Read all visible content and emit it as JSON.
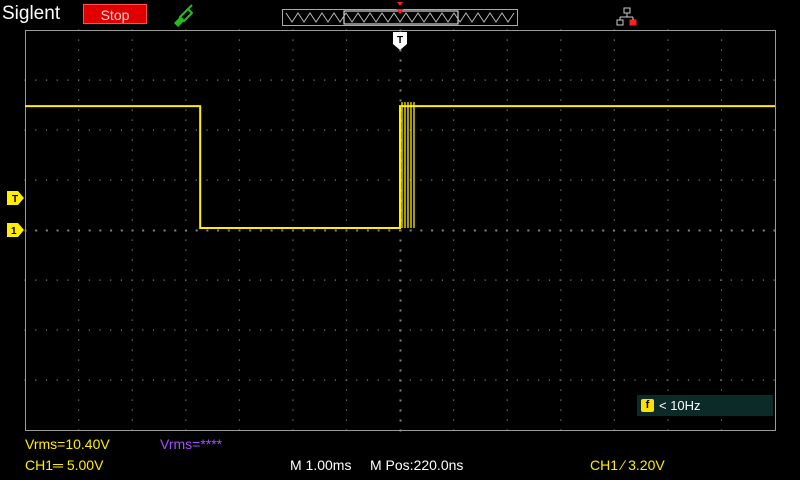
{
  "header": {
    "brand": "Siglent",
    "run_state": "Stop",
    "trigger_pos_marker": "T"
  },
  "markers": {
    "trigger_level": "T",
    "channel1": "1"
  },
  "frequency": {
    "icon_label": "f",
    "text": "< 10Hz"
  },
  "measurements": {
    "vrms_ch1": "Vrms=10.40V",
    "vrms_ch2": "Vrms=****"
  },
  "status": {
    "ch1_scale": "CH1═ 5.00V",
    "timebase": "M 1.00ms",
    "mpos": "M Pos:220.0ns",
    "trigger": "CH1 ∕ 3.20V"
  },
  "colors": {
    "trace": "#ffee00",
    "grid": "#808080",
    "run_state_bg": "#e00000",
    "probe_icon": "#20c020"
  },
  "waveform": {
    "high_level_div": 2.4,
    "low_level_div": 0,
    "fall_time_ms": -3.73,
    "rise_time_ms": 0,
    "time_per_div_ms": 1.0,
    "volts_per_div": 5.0
  }
}
